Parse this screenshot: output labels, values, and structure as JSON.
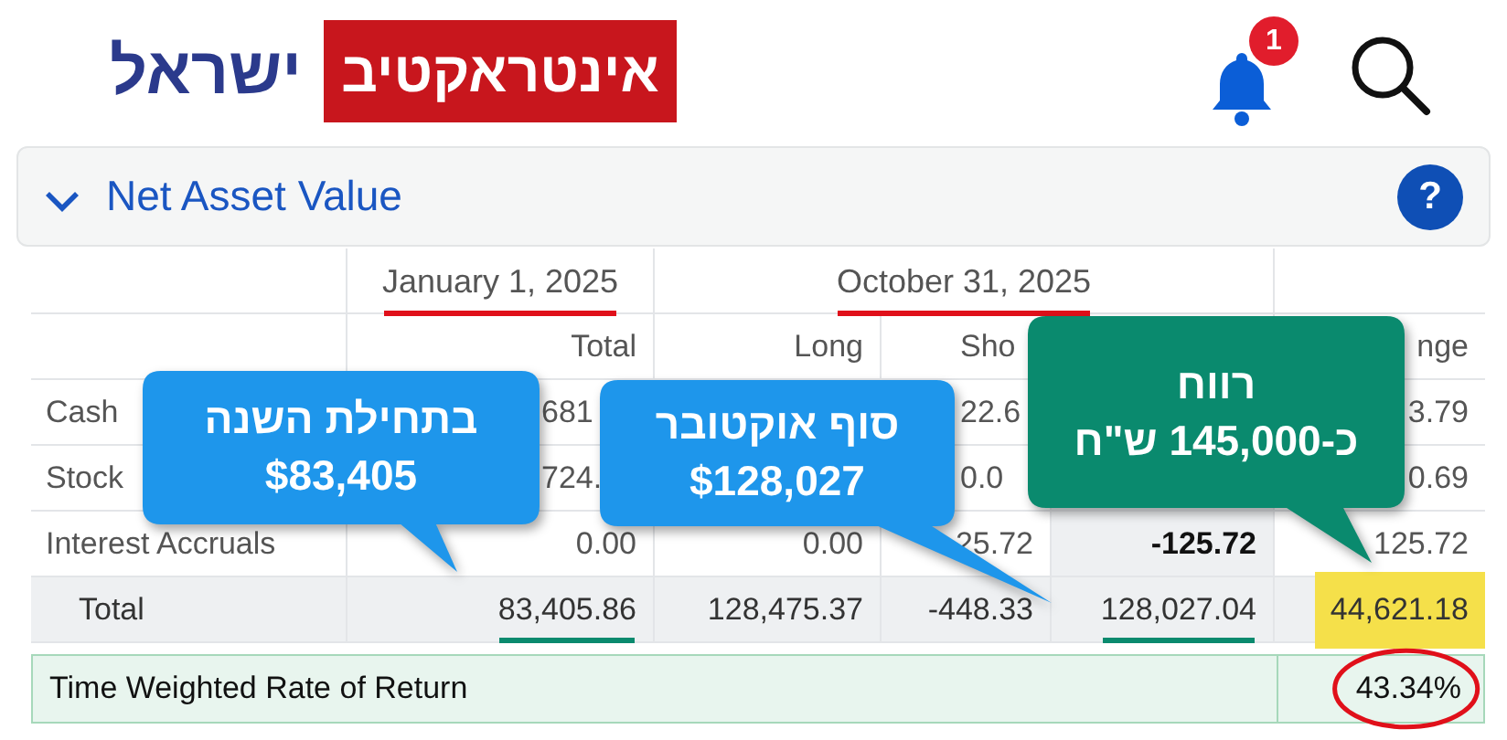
{
  "header": {
    "logo_text": "ישראל",
    "logo_box_text": "אינטראקטיב",
    "notification_count": "1"
  },
  "panel": {
    "title": "Net Asset Value",
    "expanded": true,
    "help": "?"
  },
  "table": {
    "period_headers": [
      {
        "text": "January 1, 2025",
        "annotation": {
          "kind": "underline",
          "color": "#e0101a"
        }
      },
      {
        "text": "October 31, 2025",
        "annotation": {
          "kind": "underline",
          "color": "#e0101a"
        }
      }
    ],
    "columns": [
      {
        "text": "Total"
      },
      {
        "text": "Long"
      },
      {
        "text": "Sho",
        "kind": "cut"
      },
      null,
      {
        "text": "nge"
      }
    ],
    "rows": [
      {
        "label": "Cash",
        "cells": [
          {
            "text": "681",
            "kind": "cut"
          },
          null,
          {
            "text": "22.6",
            "kind": "cut"
          },
          null,
          {
            "text": "3.79"
          }
        ]
      },
      {
        "label": "Stock",
        "cells": [
          {
            "text": "724.",
            "kind": "cut"
          },
          null,
          {
            "text": "0.0",
            "kind": "cut"
          },
          null,
          {
            "text": "0.69"
          }
        ]
      },
      {
        "label": "Interest Accruals",
        "cells": [
          {
            "text": "0.00"
          },
          {
            "text": "0.00"
          },
          {
            "text": "25.72"
          },
          {
            "text": "-125.72",
            "bold": true
          },
          {
            "text": "125.72"
          }
        ]
      },
      {
        "label": "Total",
        "total": true,
        "cells": [
          {
            "text": "83,405.86",
            "annotation": {
              "kind": "underline",
              "color": "#0a8a6e"
            }
          },
          {
            "text": "128,475.37"
          },
          {
            "text": "-448.33"
          },
          {
            "text": "128,027.04",
            "annotation": {
              "kind": "underline",
              "color": "#0a8a6e"
            }
          },
          {
            "text": "44,621.18",
            "annotation": {
              "kind": "highlight",
              "color": "#f5e04a"
            }
          }
        ]
      }
    ],
    "return_row": {
      "label": "Time Weighted Rate of Return",
      "value": "43.34%",
      "annotation": {
        "kind": "ring",
        "color": "#e0101a"
      }
    }
  },
  "callouts": [
    {
      "lines": [
        "רווח",
        "כ-145,000 ש\"ח"
      ],
      "color": "#0a8a6e"
    },
    {
      "lines": [
        "סוף אוקטובר",
        "$128,027"
      ],
      "color": "#1e96eb"
    },
    {
      "lines": [
        "בתחילת השנה",
        "$83,405"
      ],
      "color": "#1e96eb"
    }
  ]
}
